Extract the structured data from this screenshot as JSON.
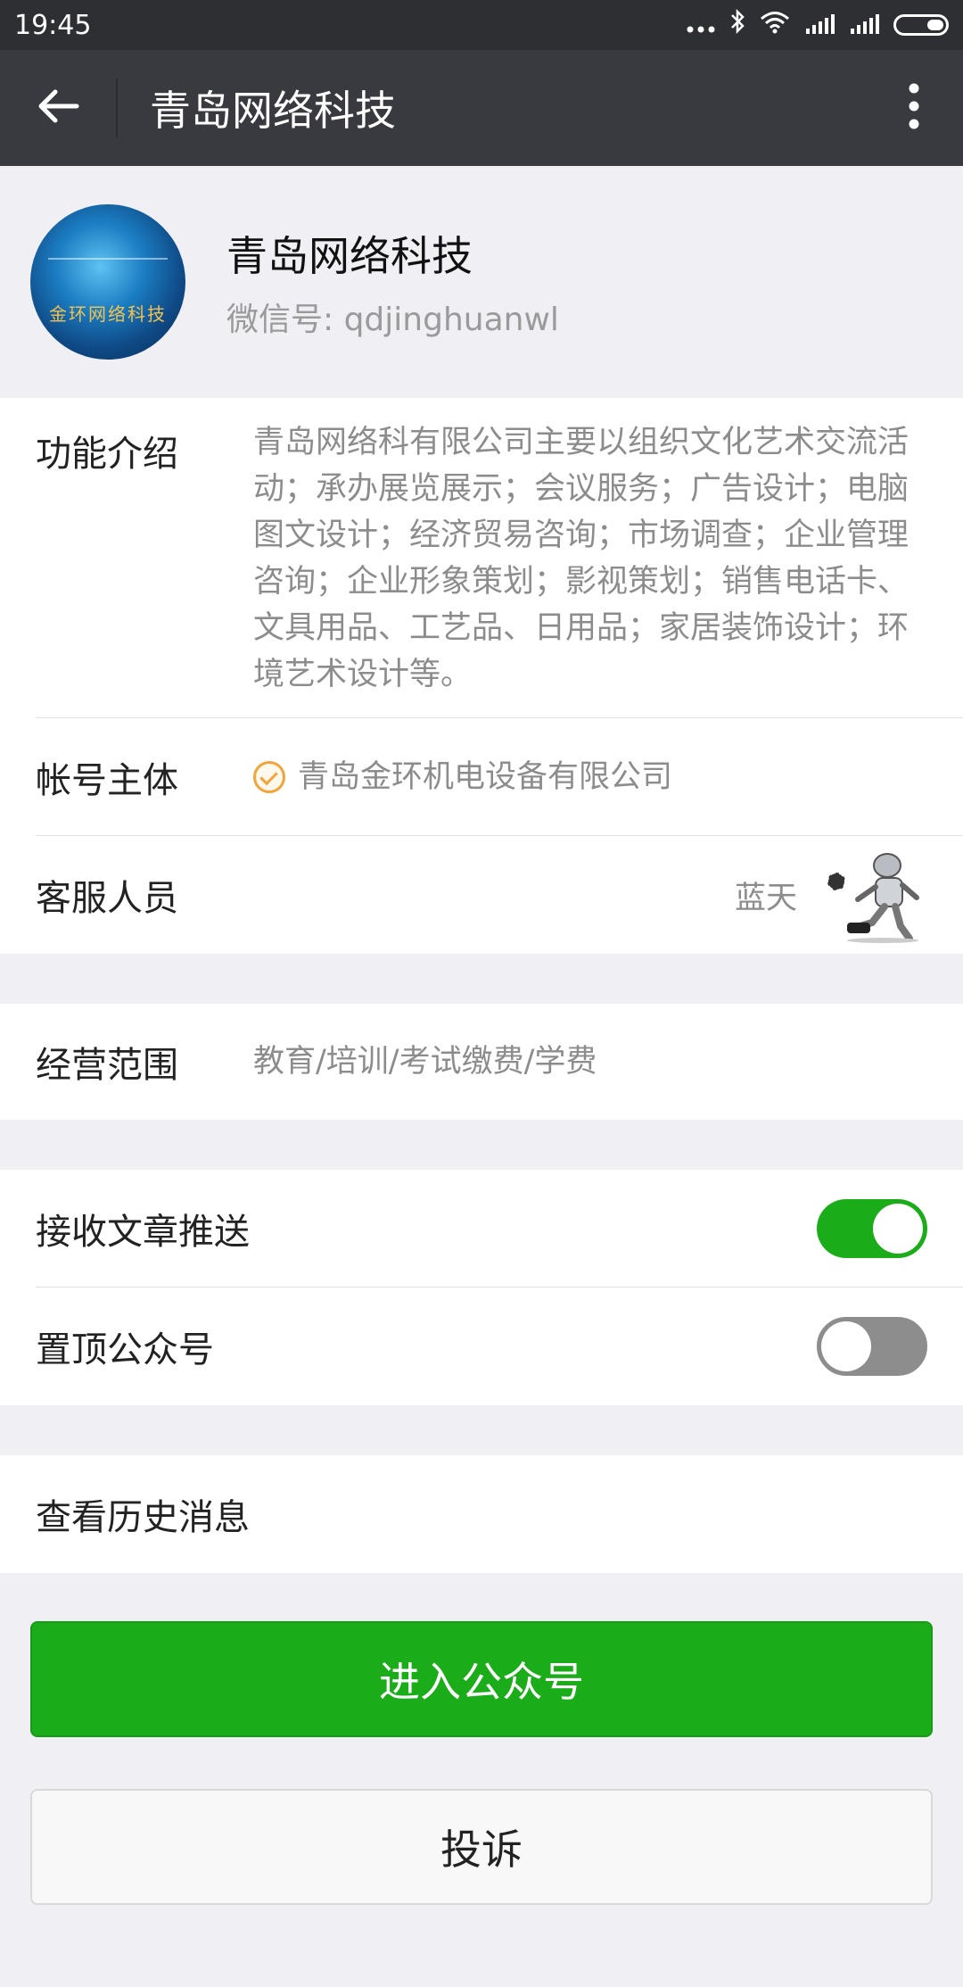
{
  "status_bar": {
    "time": "19:45",
    "icons": [
      "more-dots-icon",
      "bluetooth-icon",
      "wifi-icon",
      "signal-icon",
      "signal-icon",
      "battery-icon"
    ]
  },
  "app_bar": {
    "title": "青岛网络科技"
  },
  "profile": {
    "name": "青岛网络科技",
    "wechat_id": "微信号: qdjinghuanwl",
    "avatar_text": "金环网络科技"
  },
  "info": {
    "intro_label": "功能介绍",
    "intro_text": "青岛网络科有限公司主要以组织文化艺术交流活动；承办展览展示；会议服务；广告设计；电脑图文设计；经济贸易咨询；市场调查；企业管理咨询；企业形象策划；影视策划；销售电话卡、文具用品、工艺品、日用品；家居装饰设计；环境艺术设计等。",
    "subject_label": "帐号主体",
    "subject_value": "青岛金环机电设备有限公司",
    "service_label": "客服人员",
    "service_name": "蓝天"
  },
  "scope": {
    "label": "经营范围",
    "value": "教育/培训/考试缴费/学费"
  },
  "settings": [
    {
      "label": "接收文章推送",
      "on": true
    },
    {
      "label": "置顶公众号",
      "on": false
    }
  ],
  "history": {
    "label": "查看历史消息"
  },
  "buttons": {
    "enter": "进入公众号",
    "complain": "投诉"
  },
  "colors": {
    "accent": "#1aad19",
    "appbar": "#393a3f",
    "statusbar": "#2e2f33",
    "verified": "#f2a33a"
  }
}
